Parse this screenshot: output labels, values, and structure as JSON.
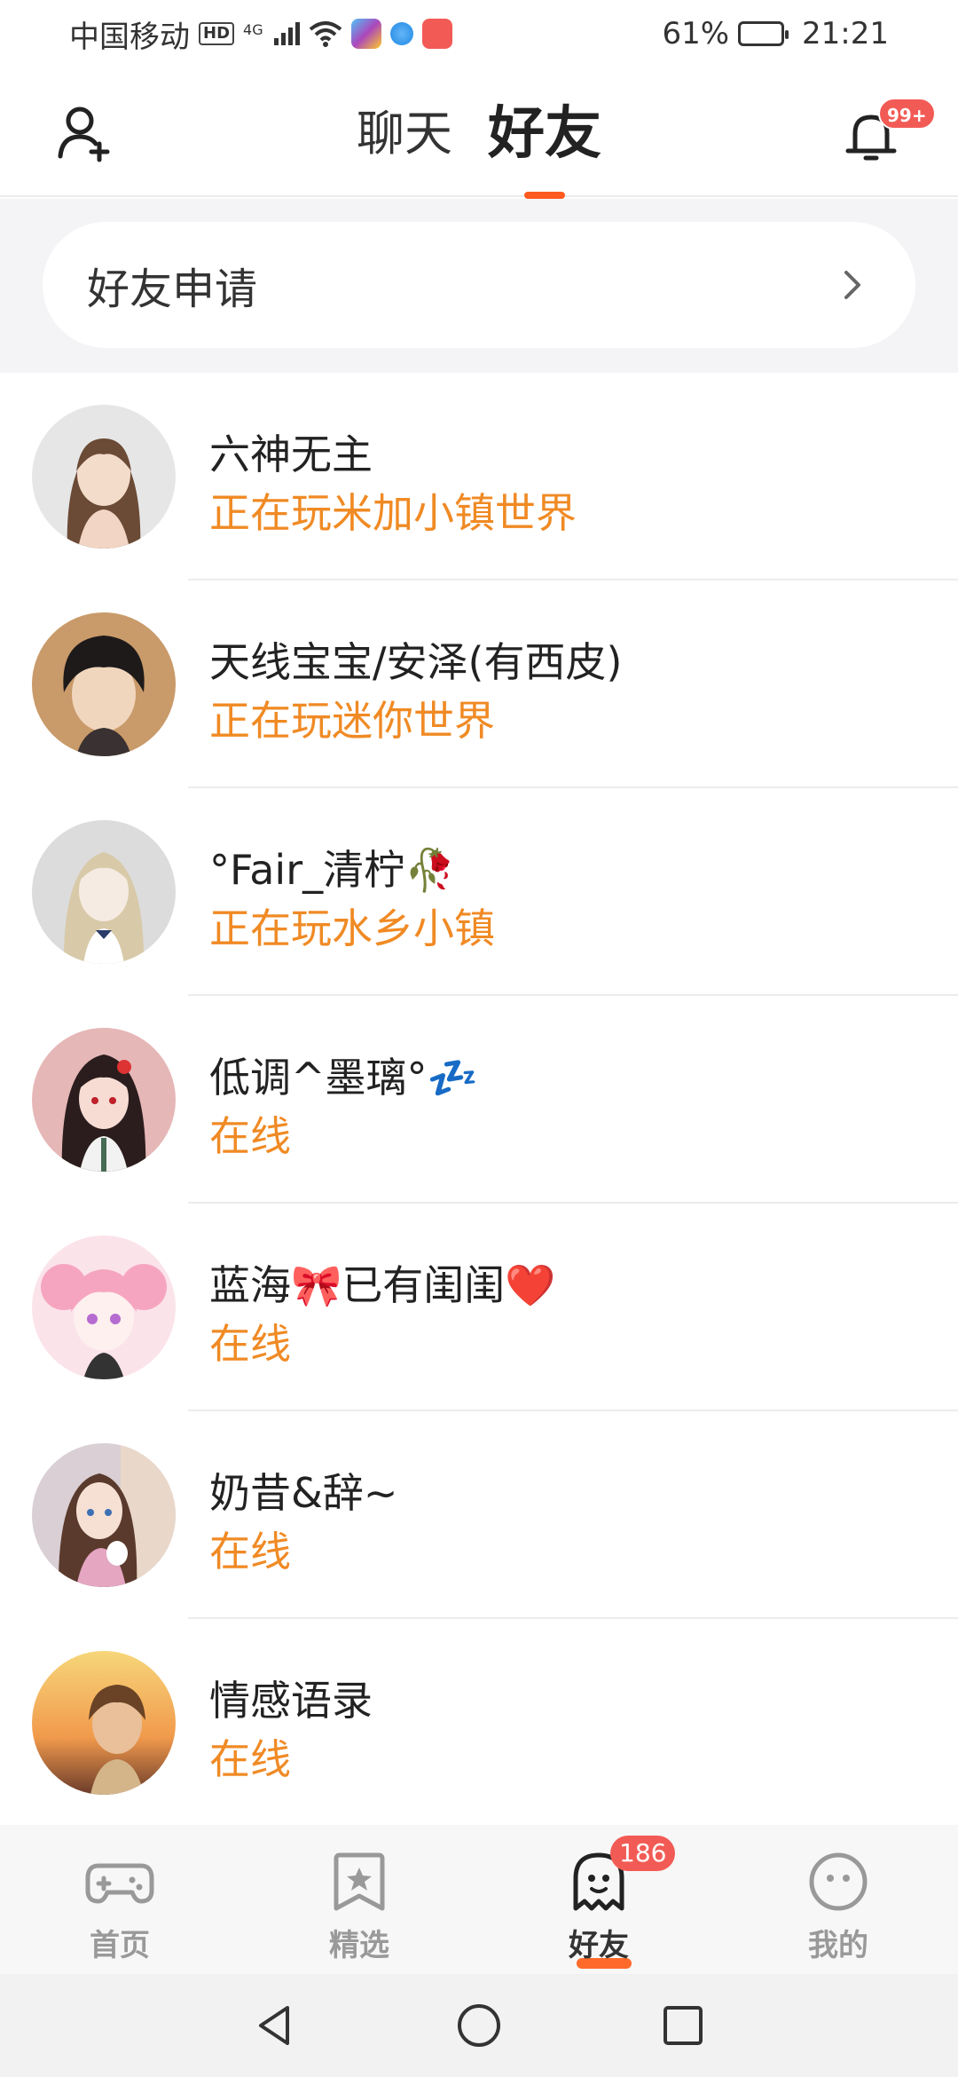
{
  "status_bar": {
    "carrier": "中国移动",
    "hd": "HD",
    "network": "4G",
    "battery": "61%",
    "battery_level": 0.61,
    "time": "21:21"
  },
  "header": {
    "tabs": [
      {
        "label": "聊天",
        "active": false
      },
      {
        "label": "好友",
        "active": true
      }
    ],
    "notification_badge": "99+"
  },
  "friend_request": {
    "label": "好友申请"
  },
  "friends": [
    {
      "name": "六神无主",
      "status": "正在玩米加小镇世界",
      "avatar": "anime-girl-brown-hair"
    },
    {
      "name": "天线宝宝/安泽(有西皮)",
      "status": "正在玩迷你世界",
      "avatar": "anime-boy-black-hair"
    },
    {
      "name": "°Fair_清柠🥀",
      "status": "正在玩水乡小镇",
      "avatar": "anime-girl-blonde"
    },
    {
      "name": "低调^墨璃°💤",
      "status": "在线",
      "avatar": "anime-girl-red-eyes"
    },
    {
      "name": "蓝海🎀已有闺闺❤️",
      "status": "在线",
      "avatar": "anime-girl-pink-hair"
    },
    {
      "name": "奶昔&辞~",
      "status": "在线",
      "avatar": "anime-girl-with-cat"
    },
    {
      "name": "情感语录",
      "status": "在线",
      "avatar": "boy-sunset"
    }
  ],
  "bottom_nav": [
    {
      "label": "首页",
      "icon": "gamepad-icon",
      "active": false
    },
    {
      "label": "精选",
      "icon": "star-bookmark-icon",
      "active": false
    },
    {
      "label": "好友",
      "icon": "ghost-icon",
      "active": true,
      "badge": "186"
    },
    {
      "label": "我的",
      "icon": "face-icon",
      "active": false
    }
  ],
  "colors": {
    "accent": "#ff5a1f",
    "status_orange": "#f08a24",
    "badge_red": "#f25b55"
  }
}
